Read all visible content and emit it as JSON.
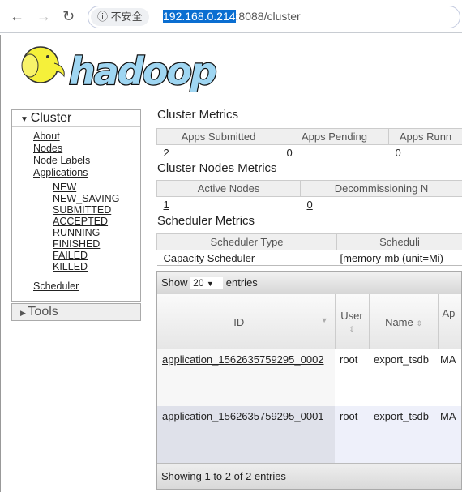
{
  "browser": {
    "security_label": "不安全",
    "url_host": "192.168.0.214",
    "url_rest": ":8088/cluster"
  },
  "logo": {
    "text": "hadoop"
  },
  "sidebar": {
    "cluster": "Cluster",
    "links": [
      "About",
      "Nodes",
      "Node Labels",
      "Applications"
    ],
    "states": [
      "NEW",
      "NEW_SAVING",
      "SUBMITTED",
      "ACCEPTED",
      "RUNNING",
      "FINISHED",
      "FAILED",
      "KILLED"
    ],
    "scheduler": "Scheduler",
    "tools": "Tools"
  },
  "cluster_metrics": {
    "title": "Cluster Metrics",
    "headers": [
      "Apps Submitted",
      "Apps Pending",
      "Apps Runn"
    ],
    "values": [
      "2",
      "0",
      "0"
    ]
  },
  "nodes_metrics": {
    "title": "Cluster Nodes Metrics",
    "headers": [
      "Active Nodes",
      "Decommissioning N"
    ],
    "values": [
      "1",
      "0"
    ]
  },
  "scheduler_metrics": {
    "title": "Scheduler Metrics",
    "headers": [
      "Scheduler Type",
      "Scheduli"
    ],
    "values": [
      "Capacity Scheduler",
      "[memory-mb (unit=Mi)"
    ]
  },
  "apps": {
    "show": "Show",
    "entries_value": "20",
    "entries": "entries",
    "headers": [
      "ID",
      "User",
      "Name",
      "Ap"
    ],
    "rows": [
      [
        "application_1562635759295_0002",
        "root",
        "export_tsdb",
        "MA"
      ],
      [
        "application_1562635759295_0001",
        "root",
        "export_tsdb",
        "MA"
      ]
    ],
    "footer": "Showing 1 to 2 of 2 entries"
  }
}
